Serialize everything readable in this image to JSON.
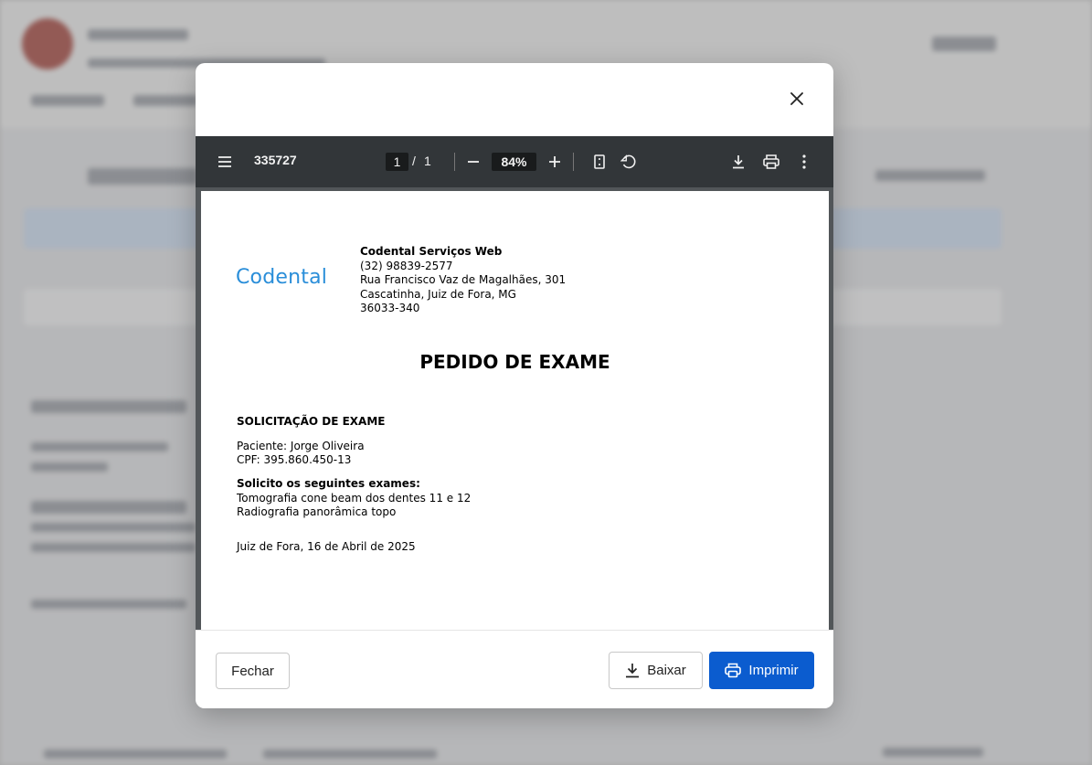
{
  "viewer": {
    "doc_id": "335727",
    "current_page": "1",
    "page_sep": "/",
    "total_pages": "1",
    "zoom": "84%"
  },
  "document": {
    "logo_text": "Codental",
    "company_name": "Codental Serviços Web",
    "phone": "(32) 98839-2577",
    "address": "Rua Francisco Vaz de Magalhães, 301",
    "city": "Cascatinha, Juiz de Fora, MG",
    "zip": "36033-340",
    "title": "PEDIDO DE EXAME",
    "section_title": "SOLICITAÇÃO DE EXAME",
    "patient": "Paciente: Jorge Oliveira",
    "cpf": "CPF: 395.860.450-13",
    "request_label": "Solicito os seguintes exames:",
    "exams": [
      "Tomografia cone beam dos dentes 11 e 12",
      "Radiografia panorâmica topo"
    ],
    "date_line": "Juiz de Fora, 16 de Abril de 2025"
  },
  "footer": {
    "close_label": "Fechar",
    "download_label": "Baixar",
    "print_label": "Imprimir"
  },
  "colors": {
    "primary": "#0b5ccf",
    "logo": "#2a8ed9",
    "toolbar": "#323639"
  },
  "icons": [
    "close-icon",
    "menu-icon",
    "minus-icon",
    "plus-icon",
    "fit-page-icon",
    "rotate-icon",
    "download-icon",
    "print-icon",
    "more-vert-icon"
  ]
}
